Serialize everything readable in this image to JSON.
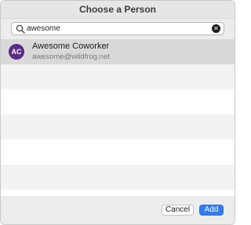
{
  "dialog": {
    "title": "Choose a Person"
  },
  "search": {
    "value": "awesome",
    "placeholder": "Search"
  },
  "results": [
    {
      "initials": "AC",
      "name": "Awesome Coworker",
      "email": "awesome@wildfrog.net",
      "avatar_color": "#5a2a86",
      "selected": true
    }
  ],
  "footer": {
    "cancel_label": "Cancel",
    "add_label": "Add"
  },
  "colors": {
    "accent": "#2f7cf6",
    "selection": "#d9d9d9"
  }
}
